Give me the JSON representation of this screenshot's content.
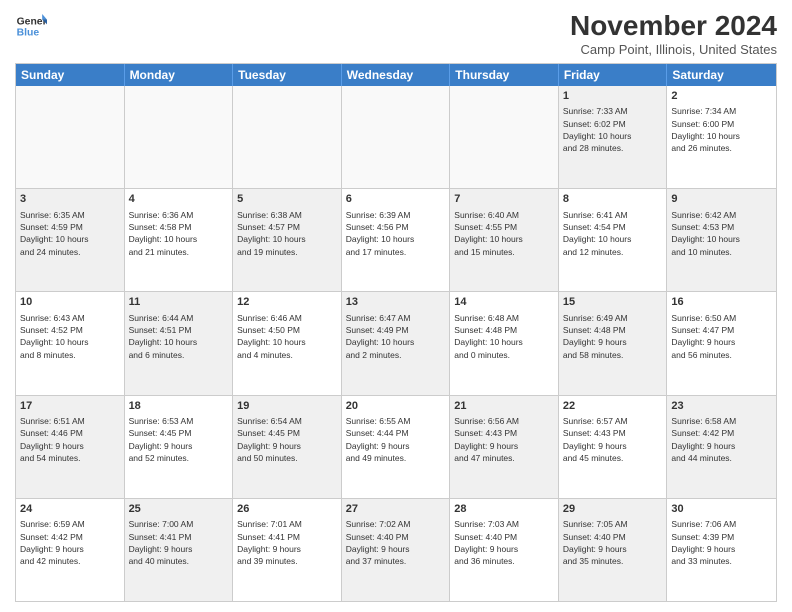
{
  "logo": {
    "line1": "General",
    "line2": "Blue"
  },
  "title": "November 2024",
  "location": "Camp Point, Illinois, United States",
  "days_of_week": [
    "Sunday",
    "Monday",
    "Tuesday",
    "Wednesday",
    "Thursday",
    "Friday",
    "Saturday"
  ],
  "rows": [
    [
      {
        "day": "",
        "empty": true
      },
      {
        "day": "",
        "empty": true
      },
      {
        "day": "",
        "empty": true
      },
      {
        "day": "",
        "empty": true
      },
      {
        "day": "",
        "empty": true
      },
      {
        "day": "1",
        "shaded": true,
        "info": "Sunrise: 7:33 AM\nSunset: 6:02 PM\nDaylight: 10 hours\nand 28 minutes."
      },
      {
        "day": "2",
        "info": "Sunrise: 7:34 AM\nSunset: 6:00 PM\nDaylight: 10 hours\nand 26 minutes."
      }
    ],
    [
      {
        "day": "3",
        "shaded": true,
        "info": "Sunrise: 6:35 AM\nSunset: 4:59 PM\nDaylight: 10 hours\nand 24 minutes."
      },
      {
        "day": "4",
        "info": "Sunrise: 6:36 AM\nSunset: 4:58 PM\nDaylight: 10 hours\nand 21 minutes."
      },
      {
        "day": "5",
        "shaded": true,
        "info": "Sunrise: 6:38 AM\nSunset: 4:57 PM\nDaylight: 10 hours\nand 19 minutes."
      },
      {
        "day": "6",
        "info": "Sunrise: 6:39 AM\nSunset: 4:56 PM\nDaylight: 10 hours\nand 17 minutes."
      },
      {
        "day": "7",
        "shaded": true,
        "info": "Sunrise: 6:40 AM\nSunset: 4:55 PM\nDaylight: 10 hours\nand 15 minutes."
      },
      {
        "day": "8",
        "info": "Sunrise: 6:41 AM\nSunset: 4:54 PM\nDaylight: 10 hours\nand 12 minutes."
      },
      {
        "day": "9",
        "shaded": true,
        "info": "Sunrise: 6:42 AM\nSunset: 4:53 PM\nDaylight: 10 hours\nand 10 minutes."
      }
    ],
    [
      {
        "day": "10",
        "info": "Sunrise: 6:43 AM\nSunset: 4:52 PM\nDaylight: 10 hours\nand 8 minutes."
      },
      {
        "day": "11",
        "shaded": true,
        "info": "Sunrise: 6:44 AM\nSunset: 4:51 PM\nDaylight: 10 hours\nand 6 minutes."
      },
      {
        "day": "12",
        "info": "Sunrise: 6:46 AM\nSunset: 4:50 PM\nDaylight: 10 hours\nand 4 minutes."
      },
      {
        "day": "13",
        "shaded": true,
        "info": "Sunrise: 6:47 AM\nSunset: 4:49 PM\nDaylight: 10 hours\nand 2 minutes."
      },
      {
        "day": "14",
        "info": "Sunrise: 6:48 AM\nSunset: 4:48 PM\nDaylight: 10 hours\nand 0 minutes."
      },
      {
        "day": "15",
        "shaded": true,
        "info": "Sunrise: 6:49 AM\nSunset: 4:48 PM\nDaylight: 9 hours\nand 58 minutes."
      },
      {
        "day": "16",
        "info": "Sunrise: 6:50 AM\nSunset: 4:47 PM\nDaylight: 9 hours\nand 56 minutes."
      }
    ],
    [
      {
        "day": "17",
        "shaded": true,
        "info": "Sunrise: 6:51 AM\nSunset: 4:46 PM\nDaylight: 9 hours\nand 54 minutes."
      },
      {
        "day": "18",
        "info": "Sunrise: 6:53 AM\nSunset: 4:45 PM\nDaylight: 9 hours\nand 52 minutes."
      },
      {
        "day": "19",
        "shaded": true,
        "info": "Sunrise: 6:54 AM\nSunset: 4:45 PM\nDaylight: 9 hours\nand 50 minutes."
      },
      {
        "day": "20",
        "info": "Sunrise: 6:55 AM\nSunset: 4:44 PM\nDaylight: 9 hours\nand 49 minutes."
      },
      {
        "day": "21",
        "shaded": true,
        "info": "Sunrise: 6:56 AM\nSunset: 4:43 PM\nDaylight: 9 hours\nand 47 minutes."
      },
      {
        "day": "22",
        "info": "Sunrise: 6:57 AM\nSunset: 4:43 PM\nDaylight: 9 hours\nand 45 minutes."
      },
      {
        "day": "23",
        "shaded": true,
        "info": "Sunrise: 6:58 AM\nSunset: 4:42 PM\nDaylight: 9 hours\nand 44 minutes."
      }
    ],
    [
      {
        "day": "24",
        "info": "Sunrise: 6:59 AM\nSunset: 4:42 PM\nDaylight: 9 hours\nand 42 minutes."
      },
      {
        "day": "25",
        "shaded": true,
        "info": "Sunrise: 7:00 AM\nSunset: 4:41 PM\nDaylight: 9 hours\nand 40 minutes."
      },
      {
        "day": "26",
        "info": "Sunrise: 7:01 AM\nSunset: 4:41 PM\nDaylight: 9 hours\nand 39 minutes."
      },
      {
        "day": "27",
        "shaded": true,
        "info": "Sunrise: 7:02 AM\nSunset: 4:40 PM\nDaylight: 9 hours\nand 37 minutes."
      },
      {
        "day": "28",
        "info": "Sunrise: 7:03 AM\nSunset: 4:40 PM\nDaylight: 9 hours\nand 36 minutes."
      },
      {
        "day": "29",
        "shaded": true,
        "info": "Sunrise: 7:05 AM\nSunset: 4:40 PM\nDaylight: 9 hours\nand 35 minutes."
      },
      {
        "day": "30",
        "info": "Sunrise: 7:06 AM\nSunset: 4:39 PM\nDaylight: 9 hours\nand 33 minutes."
      }
    ]
  ]
}
